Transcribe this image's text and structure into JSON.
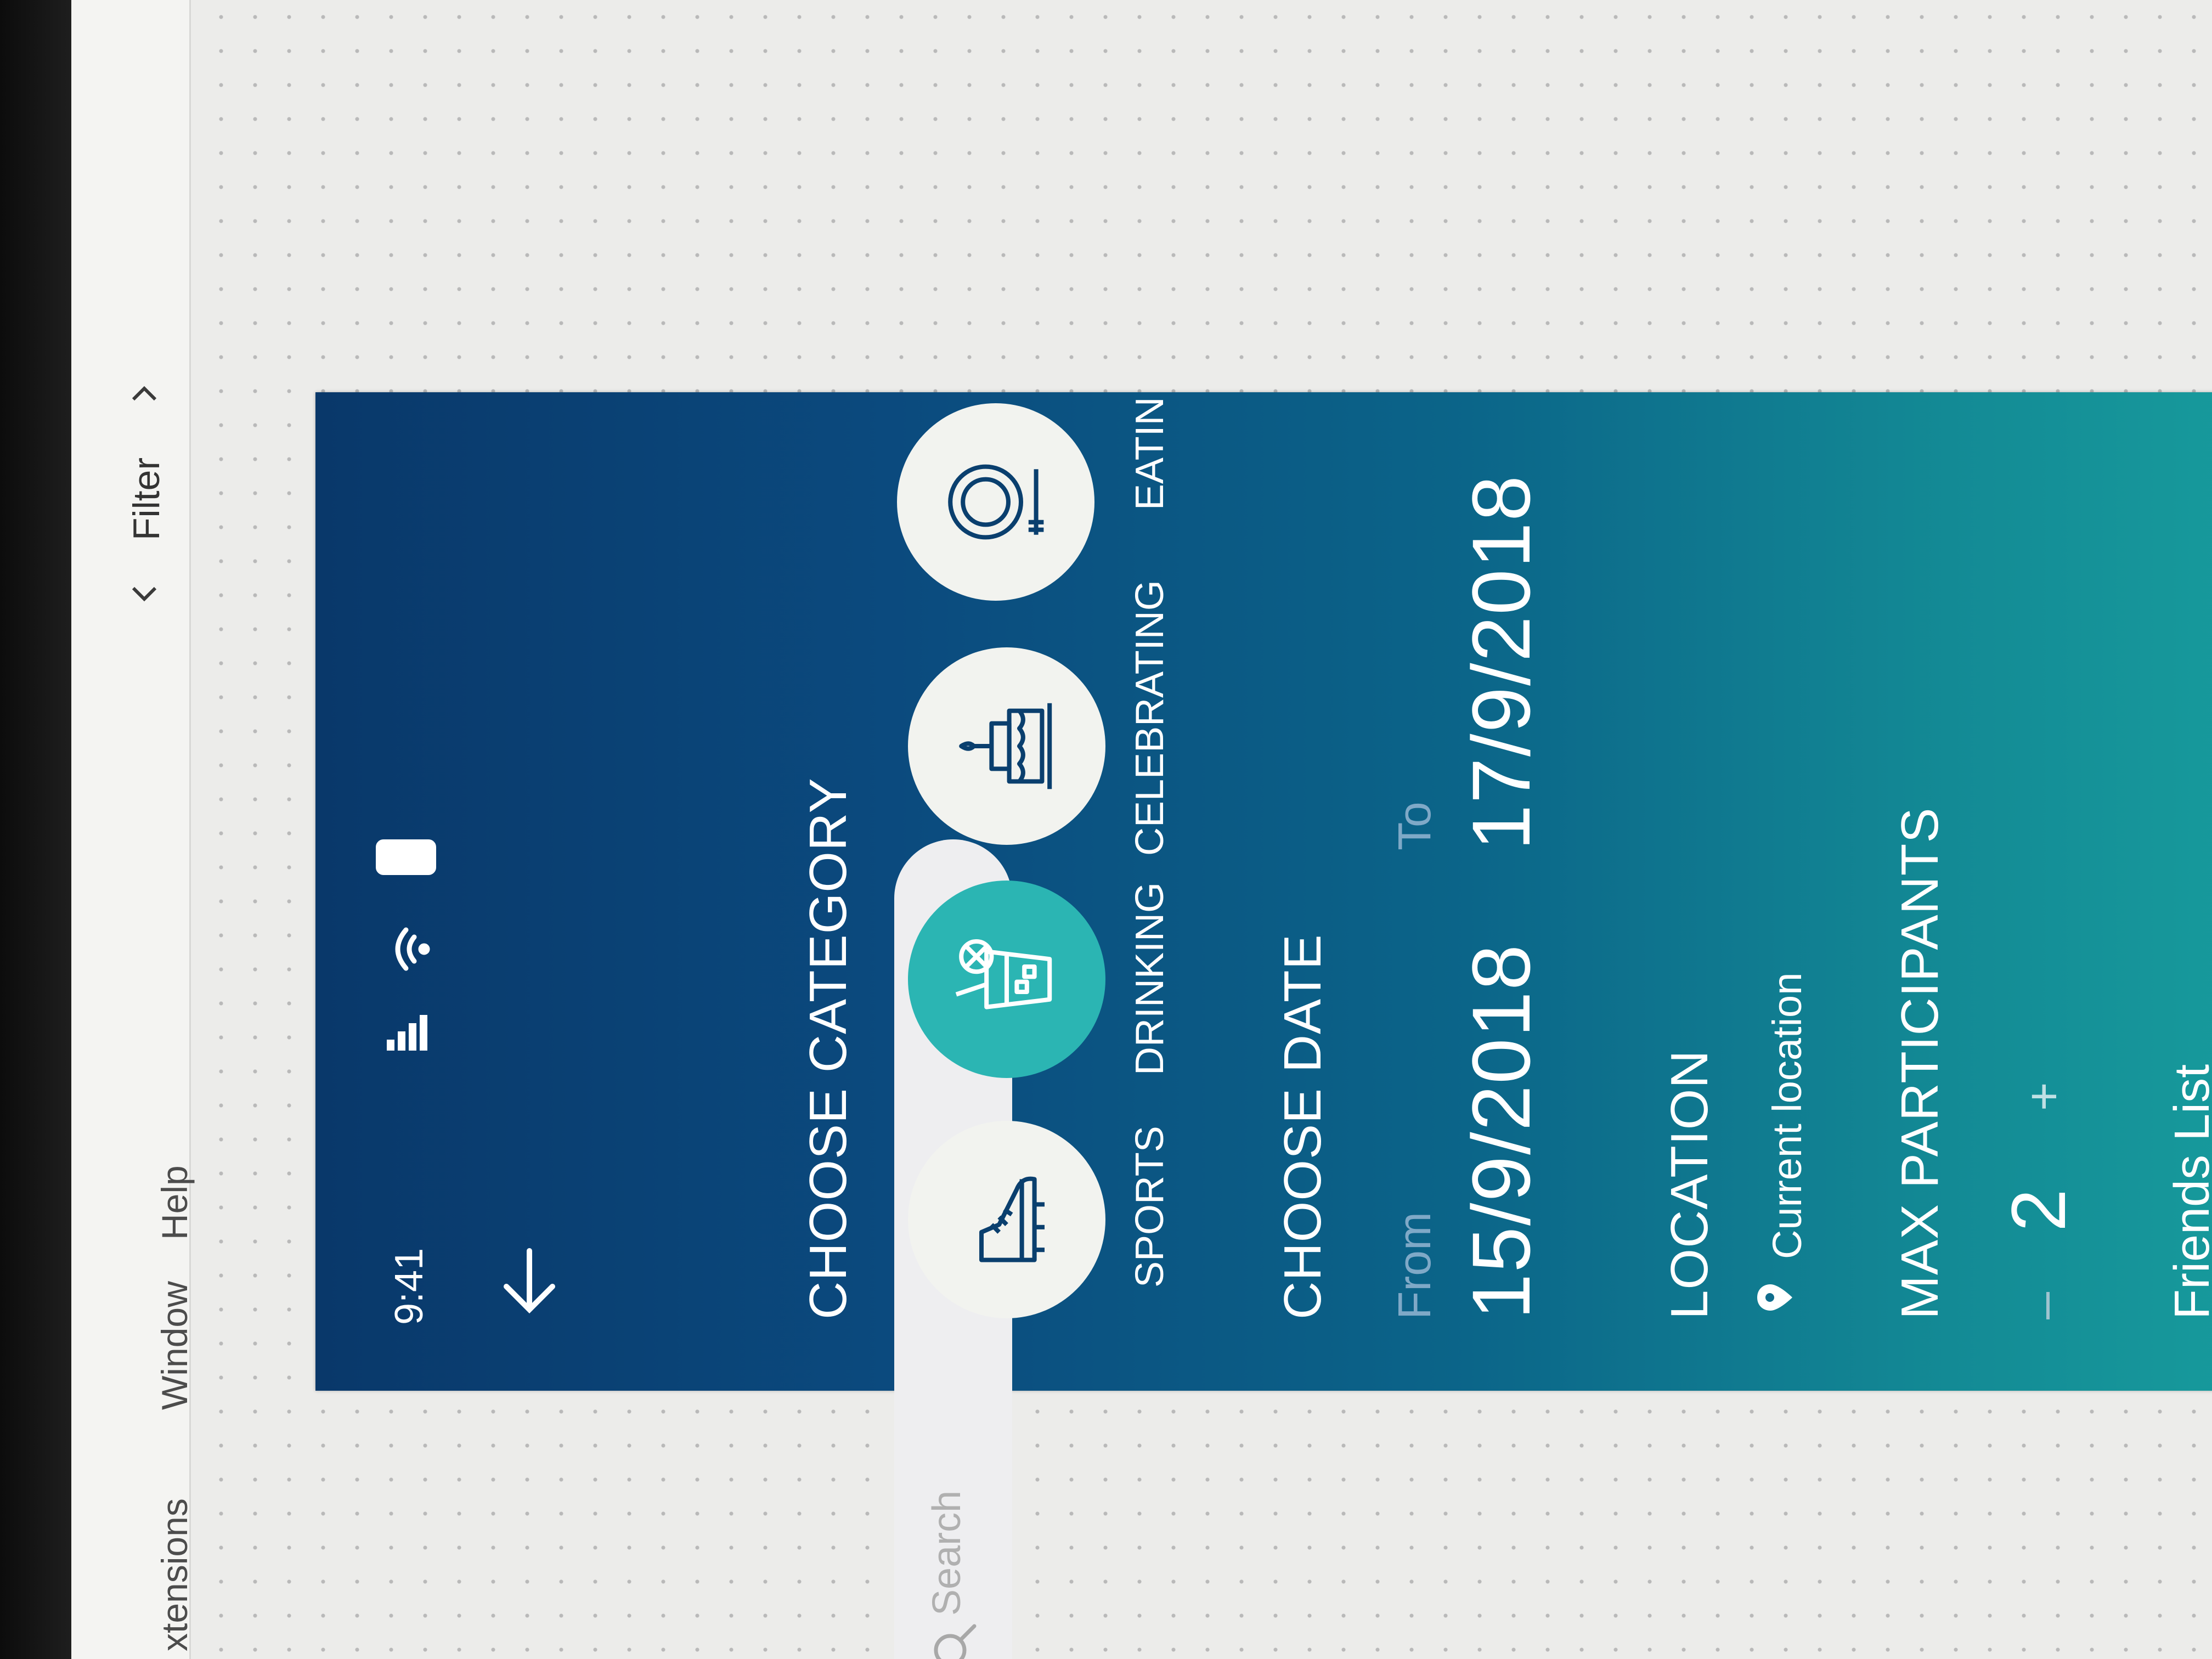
{
  "menu": {
    "items": [
      "xtensions",
      "Window",
      "Help"
    ]
  },
  "toolbar": {
    "filter_label": "Filter",
    "prev_icon": "chevron-left-icon",
    "next_icon": "chevron-right-icon"
  },
  "status_bar": {
    "time": "9:41",
    "signal_icon": "signal-icon",
    "wifi_icon": "wifi-icon",
    "battery_icon": "battery-icon"
  },
  "header": {
    "back_icon": "arrow-down-icon"
  },
  "search": {
    "placeholder": "Search",
    "icon": "search-icon"
  },
  "category": {
    "title": "CHOOSE CATEGORY",
    "items": [
      {
        "label": "SPORTS",
        "icon": "sneaker-icon",
        "selected": false
      },
      {
        "label": "DRINKING",
        "icon": "drink-icon",
        "selected": true
      },
      {
        "label": "CELEBRATING",
        "icon": "cake-icon",
        "selected": false
      },
      {
        "label": "EATIN",
        "icon": "plate-icon",
        "selected": false
      }
    ]
  },
  "date": {
    "title": "CHOOSE DATE",
    "from_label": "From",
    "from_value": "15/9/2018",
    "to_label": "To",
    "to_value": "17/9/2018"
  },
  "location": {
    "title": "LOCATION",
    "value": "Current location",
    "icon": "location-pin-icon"
  },
  "participants": {
    "title": "MAX PARTICIPANTS",
    "minus": "–",
    "value": "2",
    "plus": "+"
  },
  "friends": {
    "title": "Friends List"
  },
  "colors": {
    "bg_start": "#09386a",
    "bg_end": "#179a9c",
    "accent": "#2bb5b3",
    "circle": "#f2f3ef",
    "icon_stroke": "#0a3f6e"
  }
}
